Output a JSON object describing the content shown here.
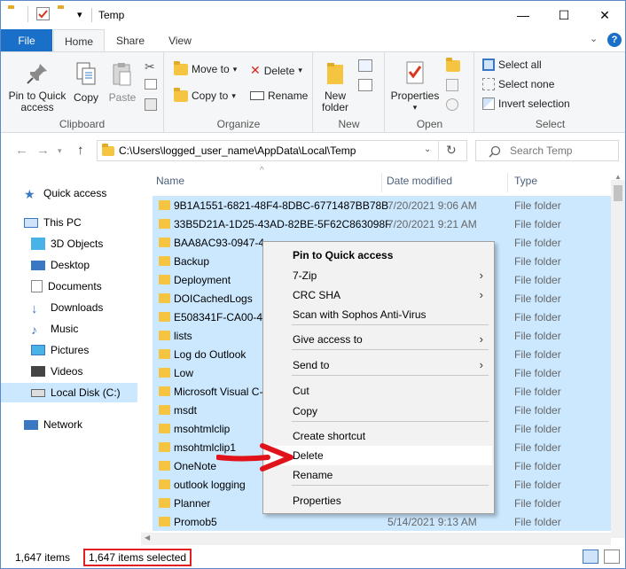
{
  "window": {
    "title": "Temp",
    "qat_dropdown": "▾",
    "minimize": "—",
    "maximize": "☐",
    "close": "✕"
  },
  "tabs": {
    "file": "File",
    "home": "Home",
    "share": "Share",
    "view": "View",
    "collapse": "⌄",
    "help": "?"
  },
  "ribbon": {
    "clipboard": {
      "label": "Clipboard",
      "pin": "Pin to Quick access",
      "copy": "Copy",
      "paste": "Paste"
    },
    "organize": {
      "label": "Organize",
      "move_to": "Move to",
      "copy_to": "Copy to",
      "delete": "Delete",
      "rename": "Rename"
    },
    "new": {
      "label": "New",
      "new_folder": "New folder"
    },
    "open": {
      "label": "Open",
      "properties": "Properties"
    },
    "select": {
      "label": "Select",
      "select_all": "Select all",
      "select_none": "Select none",
      "invert": "Invert selection"
    }
  },
  "address": {
    "path": "C:\\Users\\logged_user_name\\AppData\\Local\\Temp",
    "search_placeholder": "Search Temp"
  },
  "nav": {
    "items": [
      {
        "label": "Quick access"
      },
      {
        "label": "This PC"
      },
      {
        "label": "3D Objects"
      },
      {
        "label": "Desktop"
      },
      {
        "label": "Documents"
      },
      {
        "label": "Downloads"
      },
      {
        "label": "Music"
      },
      {
        "label": "Pictures"
      },
      {
        "label": "Videos"
      },
      {
        "label": "Local Disk (C:)"
      },
      {
        "label": "Network"
      }
    ]
  },
  "columns": {
    "name": "Name",
    "date": "Date modified",
    "type": "Type"
  },
  "files": [
    {
      "name": "9B1A1551-6821-48F4-8DBC-6771487BB78B",
      "date": "7/20/2021 9:06 AM",
      "type": "File folder"
    },
    {
      "name": "33B5D21A-1D25-43AD-82BE-5F62C863098F",
      "date": "7/20/2021 9:21 AM",
      "type": "File folder"
    },
    {
      "name": "BAA8AC93-0947-4",
      "date": "",
      "type": "File folder"
    },
    {
      "name": "Backup",
      "date": "",
      "type": "File folder"
    },
    {
      "name": "Deployment",
      "date": "",
      "type": "File folder"
    },
    {
      "name": "DOICachedLogs",
      "date": "",
      "type": "File folder"
    },
    {
      "name": "E508341F-CA00-42",
      "date": "",
      "type": "File folder"
    },
    {
      "name": "lists",
      "date": "",
      "type": "File folder"
    },
    {
      "name": "Log do Outlook",
      "date": "",
      "type": "File folder"
    },
    {
      "name": "Low",
      "date": "",
      "type": "File folder"
    },
    {
      "name": "Microsoft Visual C-",
      "date": "",
      "type": "File folder"
    },
    {
      "name": "msdt",
      "date": "",
      "type": "File folder"
    },
    {
      "name": "msohtmlclip",
      "date": "",
      "type": "File folder"
    },
    {
      "name": "msohtmlclip1",
      "date": "",
      "type": "File folder"
    },
    {
      "name": "OneNote",
      "date": "",
      "type": "File folder"
    },
    {
      "name": "outlook logging",
      "date": "",
      "type": "File folder"
    },
    {
      "name": "Planner",
      "date": "",
      "type": "File folder"
    },
    {
      "name": "Promob5",
      "date": "5/14/2021 9:13 AM",
      "type": "File folder"
    }
  ],
  "context_menu": {
    "items": [
      {
        "label": "Pin to Quick access",
        "bold": true
      },
      {
        "label": "7-Zip",
        "submenu": true
      },
      {
        "label": "CRC SHA",
        "submenu": true
      },
      {
        "label": "Scan with Sophos Anti-Virus"
      },
      {
        "label": "Give access to",
        "submenu": true
      },
      {
        "label": "Send to",
        "submenu": true
      },
      {
        "label": "Cut"
      },
      {
        "label": "Copy"
      },
      {
        "label": "Create shortcut"
      },
      {
        "label": "Delete"
      },
      {
        "label": "Rename"
      },
      {
        "label": "Properties"
      }
    ],
    "arrow_glyph": "›"
  },
  "status": {
    "count": "1,647 items",
    "selected": "1,647 items selected"
  },
  "colors": {
    "accent": "#1a6fc9",
    "selection": "#cce8ff",
    "highlight_box": "#e02020",
    "folder": "#f5c542"
  }
}
